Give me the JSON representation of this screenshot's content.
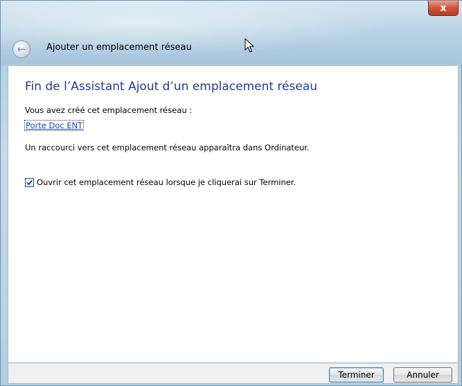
{
  "window": {
    "close_label": "x",
    "back_icon": "back-arrow-icon",
    "title": "Ajouter un emplacement réseau"
  },
  "content": {
    "heading": "Fin de l’Assistant Ajout d’un emplacement réseau",
    "created_text": "Vous avez créé cet emplacement réseau :",
    "location_link": "Porte Doc ENT",
    "shortcut_text": "Un raccourci vers cet emplacement réseau apparaîtra dans Ordinateur.",
    "open_checkbox": {
      "label": "Ouvrir cet emplacement réseau lorsque je cliquerai sur Terminer.",
      "checked": true
    }
  },
  "footer": {
    "finish_label": "Terminer",
    "cancel_label": "Annuler"
  },
  "colors": {
    "heading": "#1e3a96",
    "link": "#0b4fbf",
    "close_button": "#c9482f"
  }
}
